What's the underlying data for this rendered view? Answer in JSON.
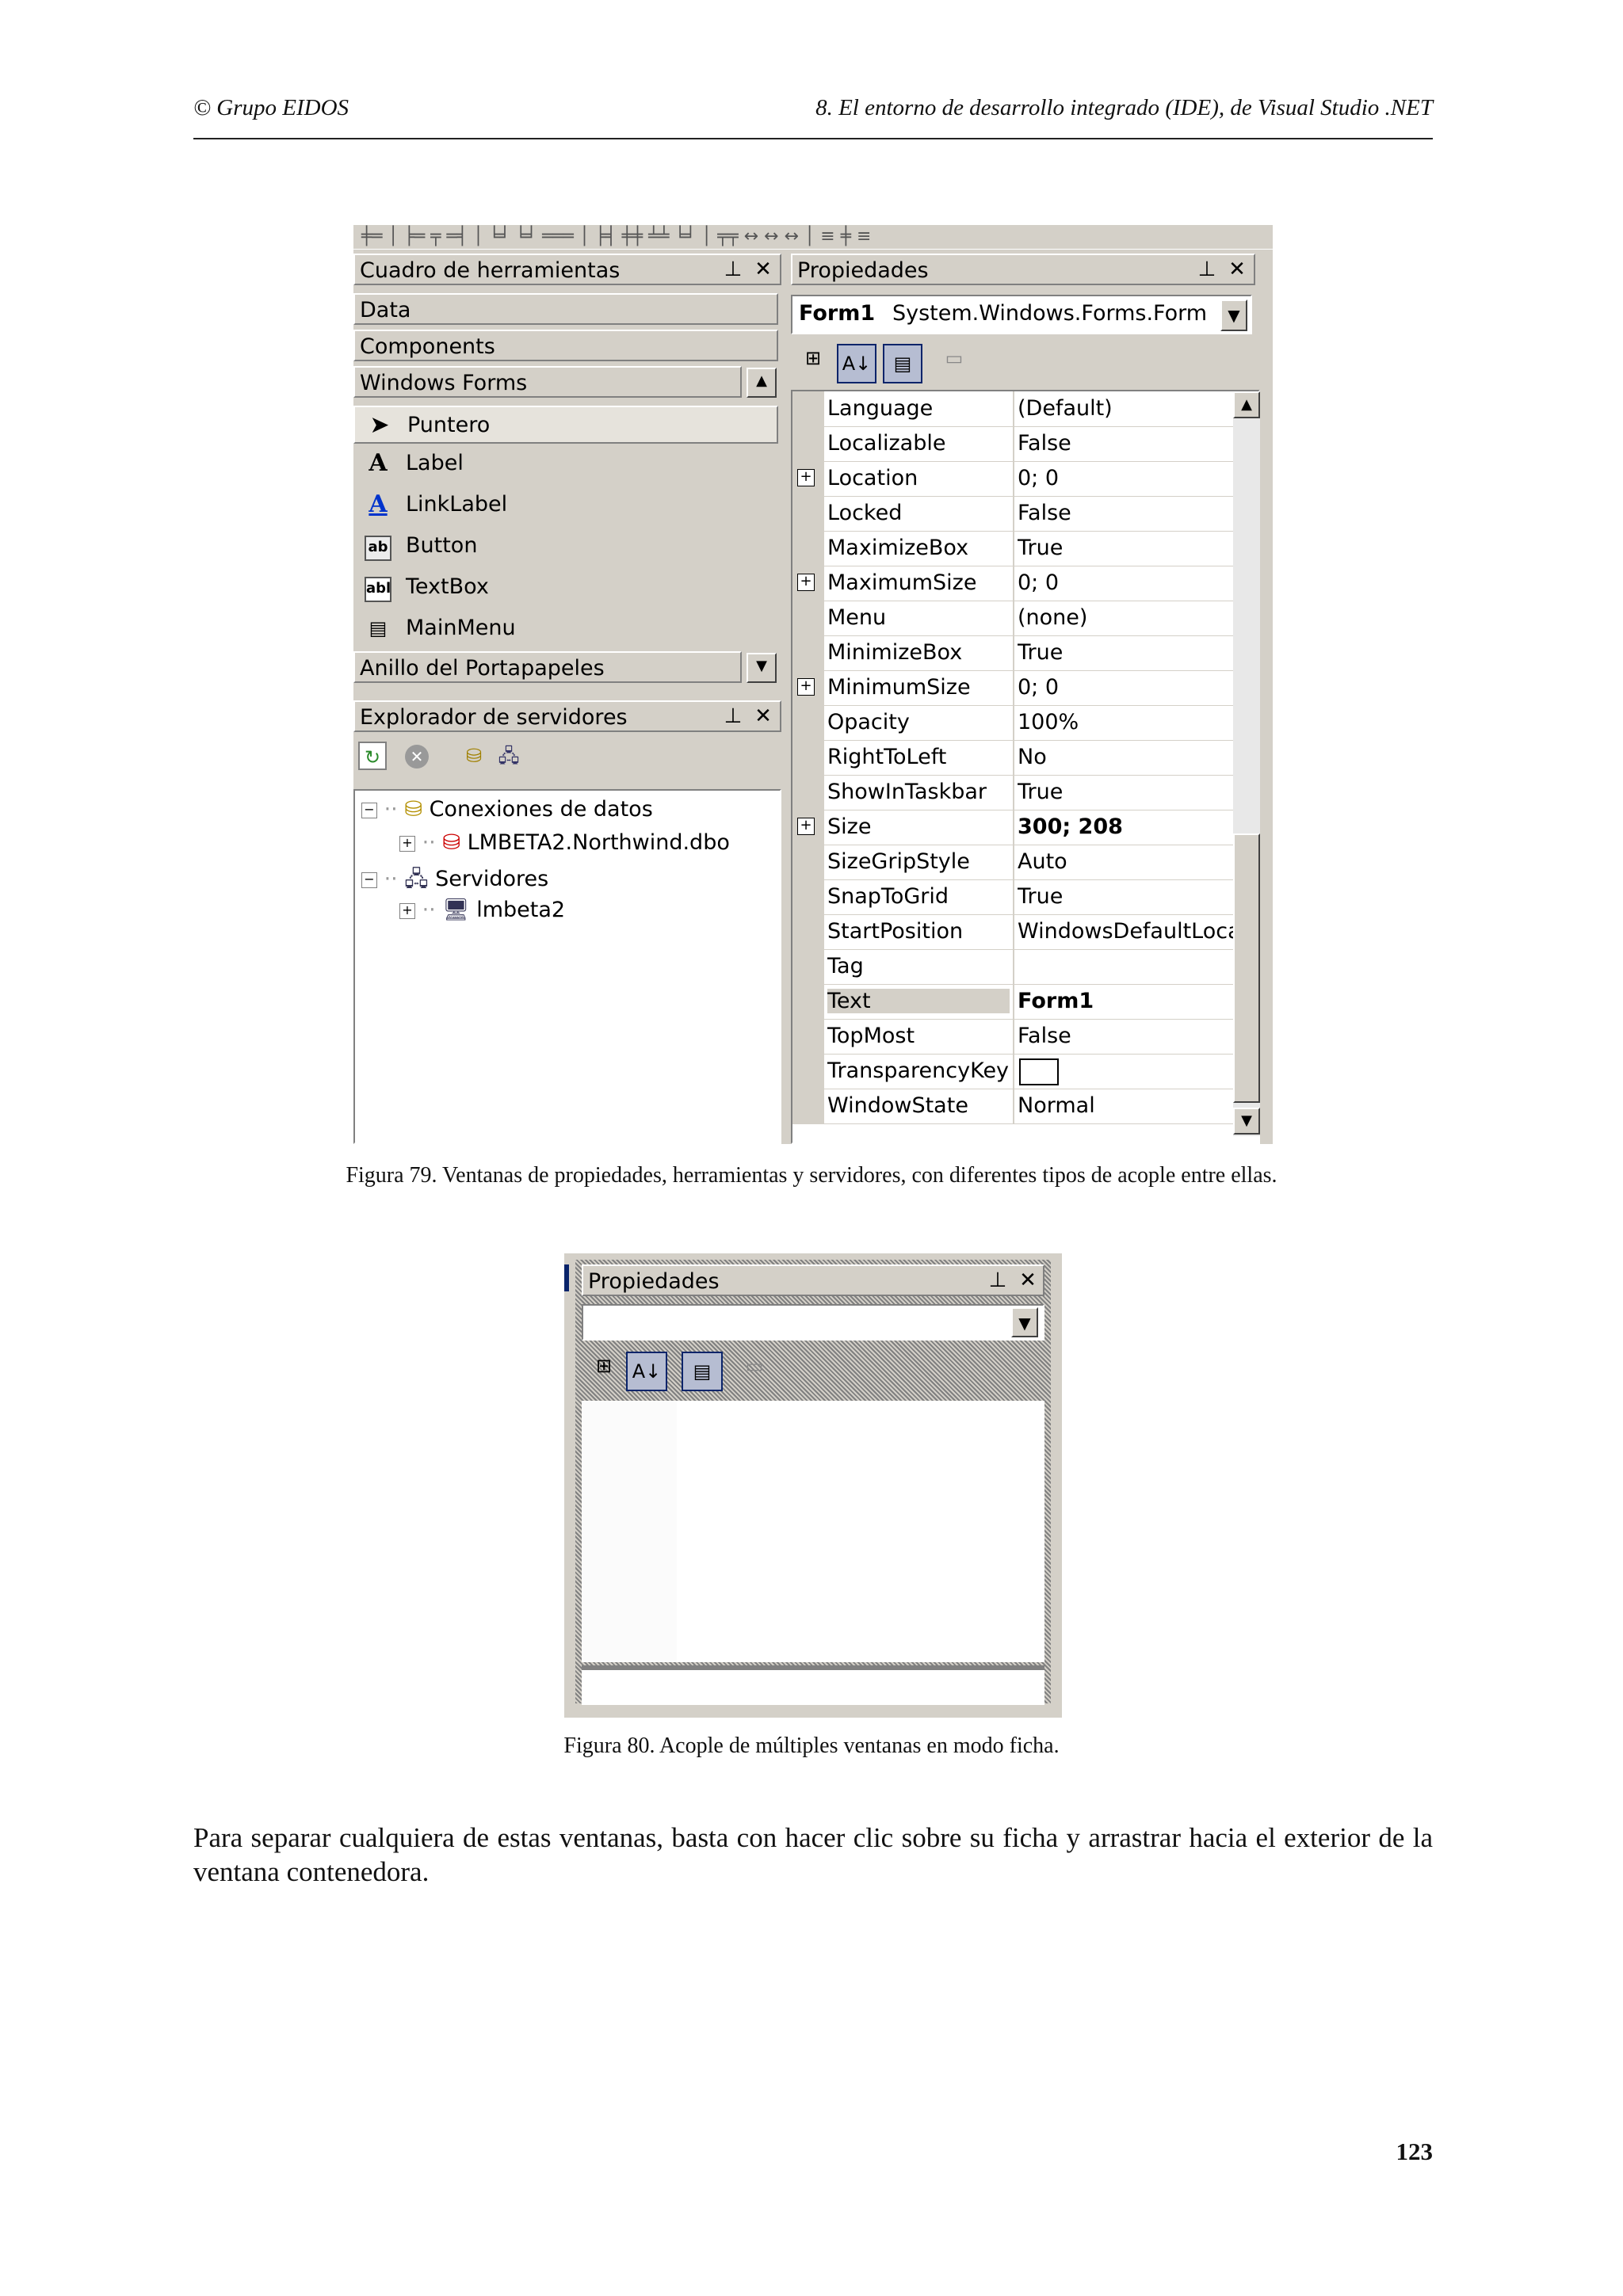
{
  "header": {
    "left": "© Grupo EIDOS",
    "right": "8. El entorno de desarrollo integrado (IDE), de Visual Studio .NET"
  },
  "figure79": {
    "caption": "Figura 79. Ventanas de propiedades, herramientas y servidores, con diferentes tipos de acople entre ellas.",
    "toolbox": {
      "title": "Cuadro de herramientas",
      "tabs": [
        "Data",
        "Components",
        "Windows Forms"
      ],
      "items": [
        {
          "label": "Puntero",
          "icon": "pointer-icon"
        },
        {
          "label": "Label",
          "icon": "label-icon"
        },
        {
          "label": "LinkLabel",
          "icon": "linklabel-icon"
        },
        {
          "label": "Button",
          "icon": "button-icon"
        },
        {
          "label": "TextBox",
          "icon": "textbox-icon"
        },
        {
          "label": "MainMenu",
          "icon": "mainmenu-icon"
        }
      ],
      "bottom_tab": "Anillo del Portapapeles"
    },
    "server_explorer": {
      "title": "Explorador de servidores",
      "tree": [
        {
          "label": "Conexiones de datos",
          "level": 0,
          "expander": "−"
        },
        {
          "label": "LMBETA2.Northwind.dbo",
          "level": 1,
          "expander": "+"
        },
        {
          "label": "Servidores",
          "level": 0,
          "expander": "−"
        },
        {
          "label": "lmbeta2",
          "level": 1,
          "expander": "+"
        }
      ]
    },
    "properties": {
      "title": "Propiedades",
      "object_name": "Form1",
      "object_type": "System.Windows.Forms.Form",
      "rows": [
        {
          "name": "Language",
          "value": "(Default)"
        },
        {
          "name": "Localizable",
          "value": "False"
        },
        {
          "name": "Location",
          "value": "0; 0",
          "expand": true
        },
        {
          "name": "Locked",
          "value": "False"
        },
        {
          "name": "MaximizeBox",
          "value": "True"
        },
        {
          "name": "MaximumSize",
          "value": "0; 0",
          "expand": true
        },
        {
          "name": "Menu",
          "value": "(none)"
        },
        {
          "name": "MinimizeBox",
          "value": "True"
        },
        {
          "name": "MinimumSize",
          "value": "0; 0",
          "expand": true
        },
        {
          "name": "Opacity",
          "value": "100%"
        },
        {
          "name": "RightToLeft",
          "value": "No"
        },
        {
          "name": "ShowInTaskbar",
          "value": "True"
        },
        {
          "name": "Size",
          "value": "300; 208",
          "expand": true,
          "bold": true
        },
        {
          "name": "SizeGripStyle",
          "value": "Auto"
        },
        {
          "name": "SnapToGrid",
          "value": "True"
        },
        {
          "name": "StartPosition",
          "value": "WindowsDefaultLocat"
        },
        {
          "name": "Tag",
          "value": ""
        },
        {
          "name": "Text",
          "value": "Form1",
          "bold": true,
          "selected": true
        },
        {
          "name": "TopMost",
          "value": "False"
        },
        {
          "name": "TransparencyKey",
          "value": "",
          "swatch": true
        },
        {
          "name": "WindowState",
          "value": "Normal"
        }
      ]
    }
  },
  "figure80": {
    "caption": "Figura 80. Acople de múltiples ventanas en modo ficha.",
    "title": "Propiedades"
  },
  "body_text": "Para separar cualquiera de estas ventanas, basta con hacer clic sobre su ficha y arrastrar hacia el exterior de la ventana contenedora.",
  "page_number": "123"
}
